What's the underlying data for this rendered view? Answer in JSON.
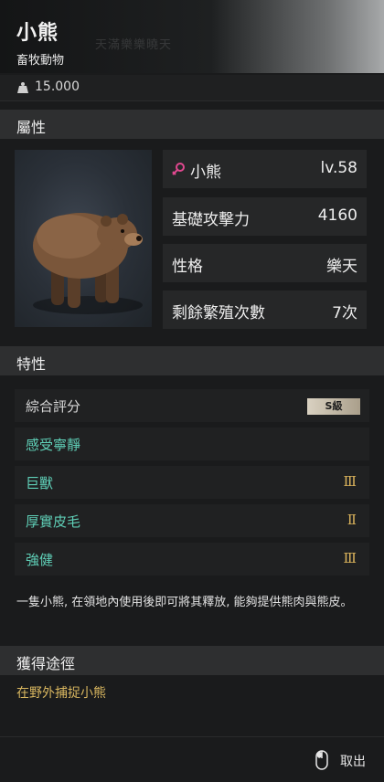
{
  "header": {
    "title": "小熊",
    "subtitle": "畜牧動物",
    "ghost_text": "天滿樂樂曉天"
  },
  "weight": {
    "icon": "weight-icon",
    "value": "15.000"
  },
  "sections": {
    "attributes": "屬性",
    "traits": "特性",
    "obtain": "獲得途徑"
  },
  "stats": {
    "name_label": "小熊",
    "level": "lv.58",
    "gender_icon": "female-icon",
    "gender_color": "#e0488f",
    "attack_label": "基礎攻擊力",
    "attack_value": "4160",
    "personality_label": "性格",
    "personality_value": "樂天",
    "breeding_label": "剩餘繁殖次數",
    "breeding_value": "7次"
  },
  "rating": {
    "label": "綜合評分",
    "badge": "S級"
  },
  "traits": [
    {
      "name": "感受寧靜",
      "level": ""
    },
    {
      "name": "巨獸",
      "level": "Ⅲ"
    },
    {
      "name": "厚實皮毛",
      "level": "Ⅱ"
    },
    {
      "name": "強健",
      "level": "Ⅲ"
    }
  ],
  "description": "一隻小熊, 在領地內使用後即可將其釋放, 能夠提供熊肉與熊皮。",
  "obtain_method": "在野外捕捉小熊",
  "footer": {
    "exit_label": "取出",
    "icon": "mouse-icon"
  },
  "colors": {
    "trait_name": "#5fcfb7",
    "trait_level": "#d9b25b",
    "source_text": "#d8b65f"
  }
}
